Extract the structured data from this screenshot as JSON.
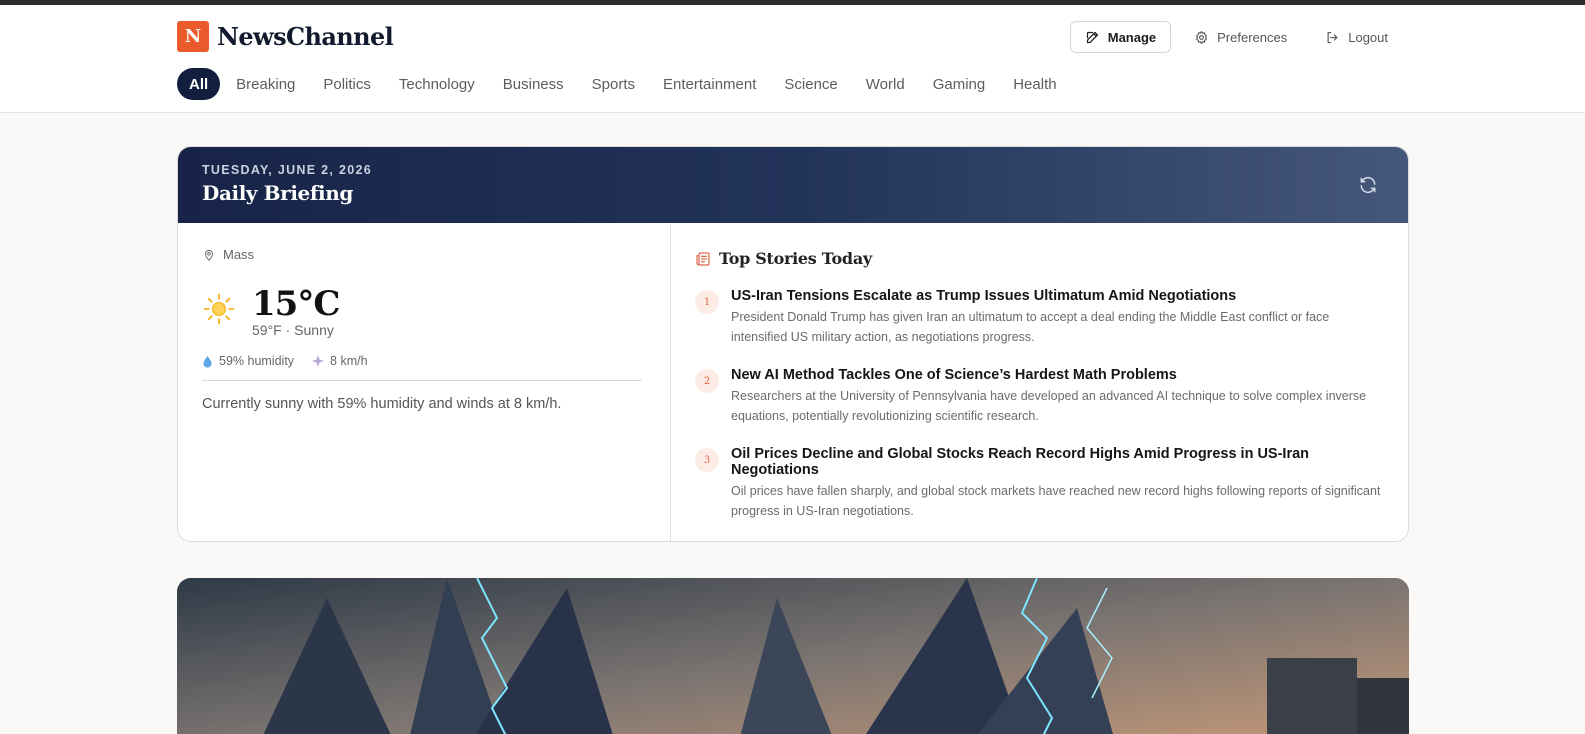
{
  "brand": {
    "mark": "N",
    "name": "NewsChannel"
  },
  "header_actions": [
    {
      "label": "Manage",
      "icon": "edit-icon"
    },
    {
      "label": "Preferences",
      "icon": "gear-icon"
    },
    {
      "label": "Logout",
      "icon": "logout-icon"
    }
  ],
  "categories": [
    "All",
    "Breaking",
    "Politics",
    "Technology",
    "Business",
    "Sports",
    "Entertainment",
    "Science",
    "World",
    "Gaming",
    "Health"
  ],
  "active_category": "All",
  "briefing": {
    "date": "TUESDAY, JUNE 2, 2026",
    "title": "Daily Briefing"
  },
  "weather": {
    "location": "Mass",
    "temp": "15°C",
    "sub": "59°F · Sunny",
    "humidity": "59% humidity",
    "wind": "8 km/h",
    "summary": "Currently sunny with 59% humidity and winds at 8 km/h."
  },
  "top_stories": {
    "title": "Top Stories Today",
    "items": [
      {
        "num": "1",
        "title": "US-Iran Tensions Escalate as Trump Issues Ultimatum Amid Negotiations",
        "desc": "President Donald Trump has given Iran an ultimatum to accept a deal ending the Middle East conflict or face intensified US military action, as negotiations progress."
      },
      {
        "num": "2",
        "title": "New AI Method Tackles One of Science’s Hardest Math Problems",
        "desc": "Researchers at the University of Pennsylvania have developed an advanced AI technique to solve complex inverse equations, potentially revolutionizing scientific research."
      },
      {
        "num": "3",
        "title": "Oil Prices Decline and Global Stocks Reach Record Highs Amid Progress in US-Iran Negotiations",
        "desc": "Oil prices have fallen sharply, and global stock markets have reached new record highs following reports of significant progress in US-Iran negotiations."
      }
    ]
  },
  "colors": {
    "brand": "#ea5a2b",
    "navy": "#121e3d"
  }
}
